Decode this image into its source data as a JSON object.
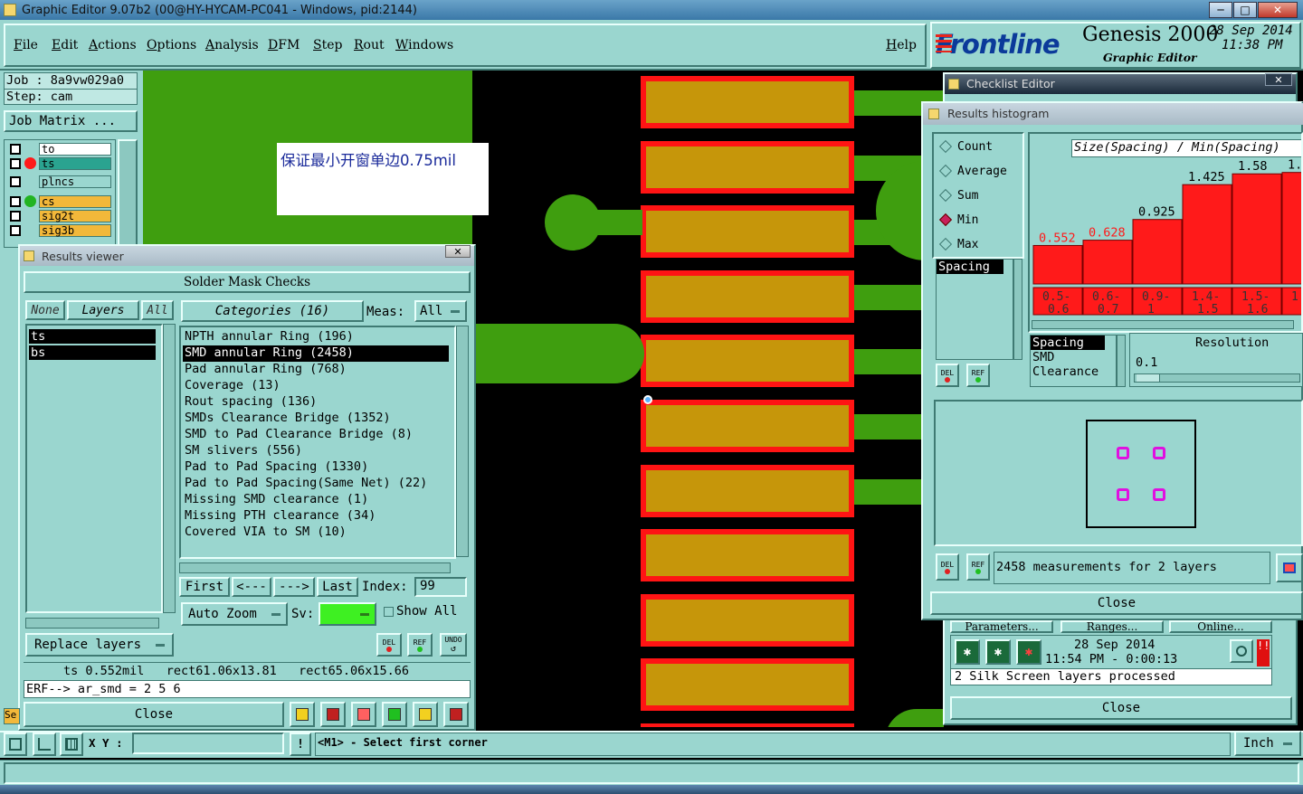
{
  "window": {
    "title": "Graphic Editor 9.07b2 (00@HY-HYCAM-PC041 - Windows, pid:2144)",
    "minimize": "─",
    "maximize": "□",
    "close": "✕"
  },
  "menu": {
    "items": [
      "File",
      "Edit",
      "Actions",
      "Options",
      "Analysis",
      "DFM",
      "Step",
      "Rout",
      "Windows"
    ],
    "help": "Help"
  },
  "brand": {
    "logo": "Frontline",
    "product": "Genesis 2000",
    "subtitle": "Graphic Editor",
    "date": "28 Sep 2014",
    "time": "11:38 PM"
  },
  "job": {
    "job_line": "Job : 8a9vw029a0",
    "step_line": "Step: cam",
    "matrix_button": "Job Matrix ..."
  },
  "layers": [
    {
      "name": "to",
      "color": "#ffffff",
      "indicator": ""
    },
    {
      "name": "ts",
      "color": "#2aa390",
      "indicator": "red"
    },
    {
      "name": "plncs",
      "color": "#9ad6cf",
      "indicator": ""
    },
    {
      "name": "cs",
      "color": "#f2b83a",
      "indicator": "green"
    },
    {
      "name": "sig2t",
      "color": "#f2b83a",
      "indicator": ""
    },
    {
      "name": "sig3b",
      "color": "#f2b83a",
      "indicator": ""
    }
  ],
  "annotation": {
    "text": "保证最小开窗单边0.75mil"
  },
  "results_viewer": {
    "title": "Results viewer",
    "close_x": "✕",
    "header": "Solder Mask Checks",
    "none_btn": "None",
    "layers_btn": "Layers",
    "all_btn": "All",
    "layer_list": [
      "ts",
      "bs"
    ],
    "categories_label": "Categories (16)",
    "meas_label": "Meas:",
    "meas_value": "All",
    "categories": [
      "NPTH annular Ring (196)",
      "SMD annular Ring (2458)",
      "Pad annular Ring (768)",
      "Coverage (13)",
      "Rout spacing (136)",
      "SMDs Clearance Bridge (1352)",
      "SMD to Pad Clearance Bridge (8)",
      "SM slivers (556)",
      "Pad to Pad Spacing (1330)",
      "Pad to Pad Spacing(Same Net) (22)",
      "Missing SMD clearance (1)",
      "Missing PTH clearance (34)",
      "Covered VIA to SM (10)"
    ],
    "selected_category": 1,
    "first_btn": "First",
    "prev_btn": "<---",
    "next_btn": "--->",
    "last_btn": "Last",
    "index_label": "Index:",
    "index_value": "99",
    "auto_zoom": "Auto Zoom",
    "sv_label": "Sv:",
    "show_all": "Show All",
    "replace_layers": "Replace layers",
    "del": "DEL",
    "ref": "REF",
    "undo": "UNDO",
    "status_line": "ts 0.552mil   rect61.06x13.81   rect65.06x15.66",
    "erf_line": "ERF--> ar_smd = 2 5 6",
    "close_btn": "Close"
  },
  "checklist_editor": {
    "title": "Checklist Editor",
    "close_x": "✕",
    "tabs": [
      "Parameters...",
      "Ranges...",
      "Online..."
    ],
    "run_date": "28 Sep 2014",
    "run_time": "11:54 PM - 0:00:13",
    "status": "2 Silk Screen layers processed",
    "close_btn": "Close"
  },
  "histogram": {
    "title": "Results histogram",
    "radio": [
      "Count",
      "Average",
      "Sum",
      "Min",
      "Max"
    ],
    "selected_radio": "Min",
    "list_top": [
      "Spacing"
    ],
    "list_bottom": [
      "Spacing",
      "SMD",
      "Clearance"
    ],
    "resolution_label": "Resolution",
    "resolution_value": "0.1",
    "del": "DEL",
    "ref": "REF",
    "summary": "2458 measurements for 2 layers",
    "close_btn": "Close"
  },
  "chart_data": {
    "type": "bar",
    "title": "Size(Spacing) / Min(Spacing)",
    "categories": [
      "0.5-0.6",
      "0.6-0.7",
      "0.9-1",
      "1.4-1.5",
      "1.5-1.6",
      "1."
    ],
    "category_top": [
      "0.5-",
      "0.6-",
      "0.9-",
      "1.4-",
      "1.5-",
      "1."
    ],
    "category_bottom": [
      "0.6",
      "0.7",
      "1",
      "1.5",
      "1.6",
      ""
    ],
    "values": [
      0.552,
      0.628,
      0.925,
      1.425,
      1.58,
      1.6
    ],
    "value_labels": [
      "0.552",
      "0.628",
      "0.925",
      "1.425",
      "1.58",
      "1."
    ],
    "ylim": [
      0,
      1.8
    ],
    "bar_color": "#ff1a1a"
  },
  "bottom_bar": {
    "xy_label": "X Y :",
    "prompt": "<M1> - Select first corner",
    "units": "Inch",
    "sel_label": "Se"
  }
}
